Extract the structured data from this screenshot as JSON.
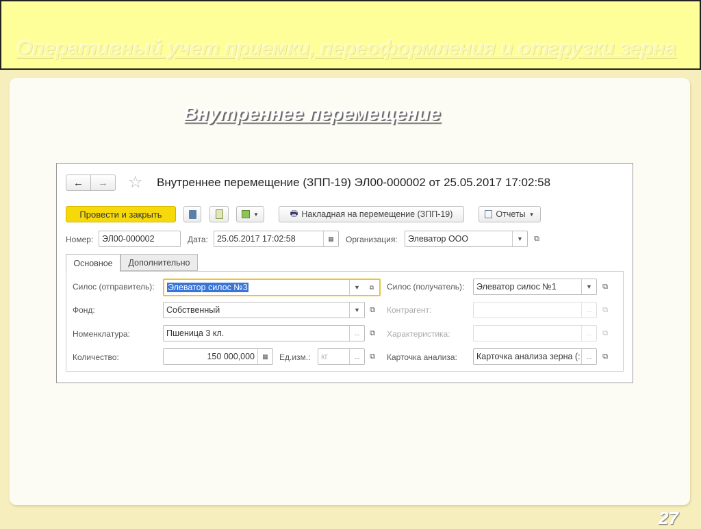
{
  "slide": {
    "title": "Оперативный учет приемки, переоформления и отгрузки зерна",
    "subtitle": "Внутреннее перемещение",
    "page_number": "27"
  },
  "form": {
    "title": "Внутреннее перемещение (ЗПП-19) ЭЛ00-000002 от 25.05.2017 17:02:58",
    "toolbar": {
      "post_close": "Провести и закрыть",
      "print_form": "Накладная на перемещение (ЗПП-19)",
      "reports": "Отчеты"
    },
    "header": {
      "number_label": "Номер:",
      "number": "ЭЛ00-000002",
      "date_label": "Дата:",
      "date": "25.05.2017 17:02:58",
      "org_label": "Организация:",
      "org": "Элеватор ООО"
    },
    "tabs": [
      {
        "label": "Основное",
        "active": true
      },
      {
        "label": "Дополнительно",
        "active": false
      }
    ],
    "fields": {
      "silo_from_label": "Силос (отправитель):",
      "silo_from": "Элеватор силос №3",
      "silo_to_label": "Силос (получатель):",
      "silo_to": "Элеватор силос №1",
      "fund_label": "Фонд:",
      "fund": "Собственный",
      "counterparty_label": "Контрагент:",
      "counterparty": "",
      "nomenclature_label": "Номенклатура:",
      "nomenclature": "Пшеница 3 кл.",
      "characteristic_label": "Характеристика:",
      "characteristic": "",
      "quantity_label": "Количество:",
      "quantity": "150 000,000",
      "unit_label": "Ед.изм.:",
      "unit_placeholder": "кг",
      "analysis_label": "Карточка анализа:",
      "analysis": "Карточка анализа зерна (:"
    }
  },
  "colors": {
    "accent_button": "#f5d90a",
    "header_bg": "#ffff99",
    "focus": "#e8c341",
    "selection": "#3875d7"
  }
}
